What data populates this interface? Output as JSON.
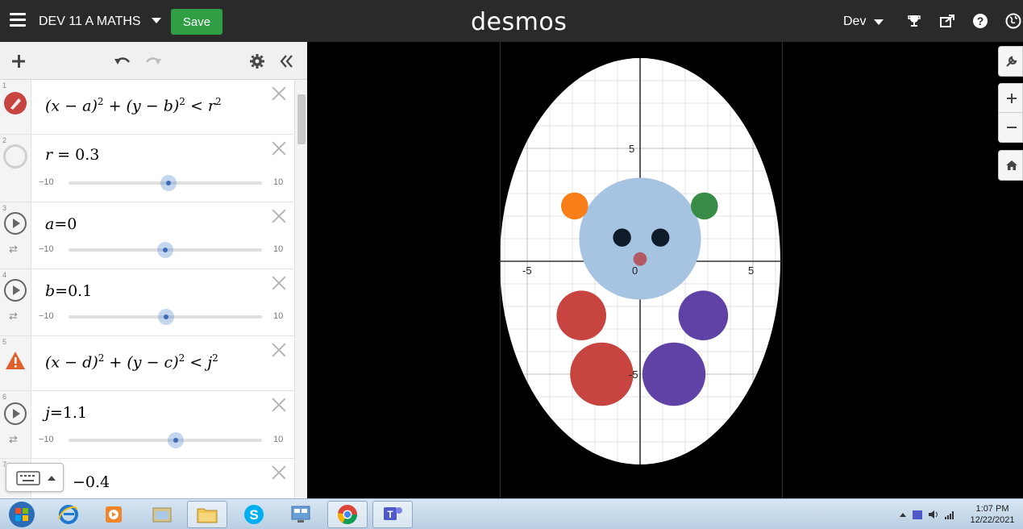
{
  "header": {
    "graph_title": "DEV 11 A MATHS",
    "save_label": "Save",
    "logo": "desmos",
    "user_label": "Dev"
  },
  "expressions": [
    {
      "num": "1",
      "type": "inequality",
      "latex": "(x − a)² + (y − b)² < r²",
      "parts": {
        "v1": "x",
        "c1": "a",
        "v2": "y",
        "c2": "b",
        "rad": "r"
      },
      "icon": "circle-edit-icon",
      "color": "#c74440"
    },
    {
      "num": "2",
      "type": "slider",
      "var": "r",
      "eq": "=",
      "value": "0.3",
      "min": "−10",
      "max": "10",
      "fraction": 0.515,
      "icon": "hidden-circle-icon"
    },
    {
      "num": "3",
      "type": "slider",
      "var": "a",
      "eq": "=",
      "value": "0",
      "min": "−10",
      "max": "10",
      "fraction": 0.5,
      "icon": "play-icon"
    },
    {
      "num": "4",
      "type": "slider",
      "var": "b",
      "eq": "=",
      "value": "0.1",
      "min": "−10",
      "max": "10",
      "fraction": 0.505,
      "icon": "play-icon"
    },
    {
      "num": "5",
      "type": "inequality",
      "latex": "(x − d)² + (y − c)² < j²",
      "parts": {
        "v1": "x",
        "c1": "d",
        "v2": "y",
        "c2": "c",
        "rad": "j"
      },
      "icon": "warning-icon",
      "color": "#e0612c"
    },
    {
      "num": "6",
      "type": "slider",
      "var": "j",
      "eq": "=",
      "value": "1.1",
      "min": "−10",
      "max": "10",
      "fraction": 0.555,
      "icon": "play-icon"
    },
    {
      "num": "7",
      "type": "partial",
      "value": "−0.4"
    }
  ],
  "graph": {
    "x_tick_labels": [
      "-5",
      "0",
      "5"
    ],
    "y_tick_labels": [
      "5",
      "-5"
    ],
    "background_shape_color": "#ffffff",
    "shapes": [
      {
        "name": "face",
        "cx": 0,
        "cy": 1.0,
        "r": 2.7,
        "color": "#a7c3e2"
      },
      {
        "name": "ear-left",
        "cx": -2.9,
        "cy": 2.45,
        "r": 0.6,
        "color": "#fa7e19"
      },
      {
        "name": "ear-right",
        "cx": 2.85,
        "cy": 2.45,
        "r": 0.6,
        "color": "#388c46"
      },
      {
        "name": "eye-left",
        "cx": -0.8,
        "cy": 1.05,
        "r": 0.4,
        "color": "#0d1b2a"
      },
      {
        "name": "eye-right",
        "cx": 0.9,
        "cy": 1.05,
        "r": 0.4,
        "color": "#0d1b2a"
      },
      {
        "name": "nose",
        "cx": 0,
        "cy": 0.1,
        "r": 0.3,
        "color": "#b25964"
      },
      {
        "name": "paw-upper-left",
        "cx": -2.6,
        "cy": -2.4,
        "r": 1.1,
        "color": "#c74440"
      },
      {
        "name": "paw-upper-right",
        "cx": 2.8,
        "cy": -2.4,
        "r": 1.1,
        "color": "#6042a6"
      },
      {
        "name": "paw-lower-left",
        "cx": -1.7,
        "cy": -5.0,
        "r": 1.4,
        "color": "#c74440"
      },
      {
        "name": "paw-lower-right",
        "cx": 1.5,
        "cy": -5.0,
        "r": 1.4,
        "color": "#6042a6"
      }
    ]
  },
  "taskbar": {
    "time": "1:07 PM",
    "date": "12/22/2021"
  }
}
